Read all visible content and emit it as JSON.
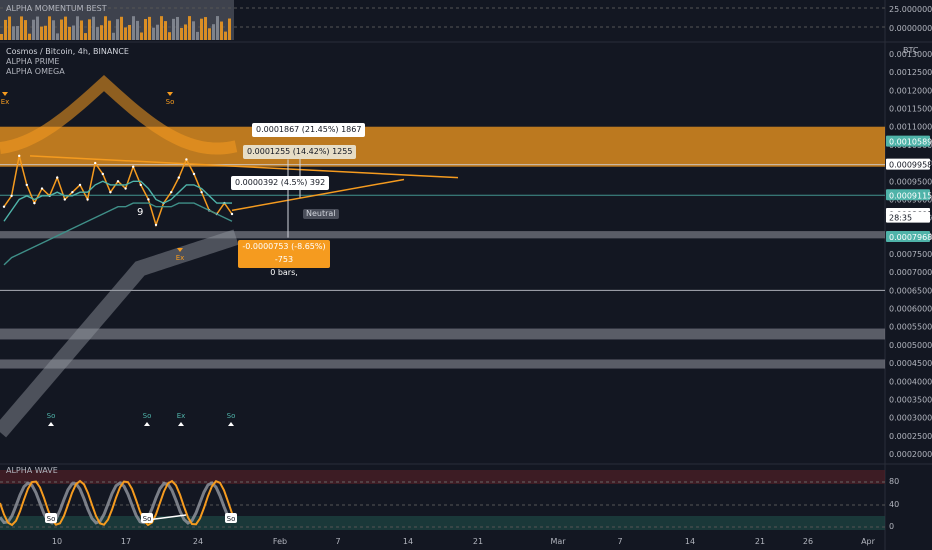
{
  "header": {
    "symbol": "Cosmos / Bitcoin, 4h, BINANCE",
    "indicator_1": "ALPHA PRIME",
    "indicator_2": "ALPHA OMEGA",
    "top_pane_title": "ALPHA MOMENTUM BEST",
    "bottom_pane_title": "ALPHA WAVE",
    "currency": "BTC"
  },
  "colors": {
    "background": "#131722",
    "orange": "#f59b1f",
    "teal": "#4fb3a9",
    "grid": "#2a2e39",
    "text": "#b2b5be",
    "white": "#ffffff"
  },
  "top_pane": {
    "axis_label": "25.0000000",
    "axis_label_2": "0.0000000"
  },
  "chart_data": {
    "type": "line",
    "title": "Cosmos / Bitcoin, 4h, BINANCE",
    "x_ticks": [
      "10",
      "17",
      "24",
      "Feb",
      "7",
      "14",
      "21",
      "Mar",
      "7",
      "14",
      "21",
      "26",
      "Apr"
    ],
    "y_ticks": [
      "0.0013000",
      "0.0012500",
      "0.0012000",
      "0.0011500",
      "0.0011000",
      "0.0010500",
      "0.0010000",
      "0.0009500",
      "0.0009000",
      "0.0008500",
      "0.0008000",
      "0.0007500",
      "0.0007000",
      "0.0006500",
      "0.0006000",
      "0.0005500",
      "0.0005000",
      "0.0004500",
      "0.0004000",
      "0.0003500",
      "0.0003000",
      "0.0002500",
      "0.0002000"
    ],
    "ylim": [
      0.0002,
      0.00135
    ],
    "price_labels": [
      {
        "text": "0.0010589",
        "value": 0.0010589,
        "style": "teal"
      },
      {
        "text": "0.0009958",
        "value": 0.0009958,
        "style": "white"
      },
      {
        "text": "0.0009115",
        "value": 0.0009115,
        "style": "teal"
      },
      {
        "text": "0.0008601",
        "value": 0.0008601,
        "style": "current"
      },
      {
        "text": "28:35",
        "value": 0.00085,
        "style": "time"
      },
      {
        "text": "0.0007968",
        "value": 0.0007968,
        "style": "teal"
      }
    ],
    "horizontal_levels": [
      0.0009958,
      0.0009115,
      0.00065
    ],
    "zones": [
      {
        "from": 0.00099,
        "to": 0.0011,
        "color": "orange"
      },
      {
        "from": 0.000793,
        "to": 0.000813,
        "color": "grey"
      },
      {
        "from": 0.000515,
        "to": 0.000545,
        "color": "grey"
      },
      {
        "from": 0.000435,
        "to": 0.00046,
        "color": "grey"
      }
    ],
    "series": [
      {
        "name": "Price",
        "values": [
          0.00088,
          0.00091,
          0.00102,
          0.00094,
          0.00089,
          0.00093,
          0.00091,
          0.00096,
          0.0009,
          0.00092,
          0.00094,
          0.0009,
          0.001,
          0.00097,
          0.00092,
          0.00095,
          0.00093,
          0.00099,
          0.00094,
          0.0009,
          0.00083,
          0.00089,
          0.00092,
          0.00096,
          0.00101,
          0.00097,
          0.00092,
          0.00087,
          0.00086,
          0.00089,
          0.00086
        ]
      },
      {
        "name": "Fast MA",
        "values": [
          0.00084,
          0.00087,
          0.0009,
          0.00091,
          0.0009,
          0.00091,
          0.00091,
          0.00092,
          0.00091,
          0.00091,
          0.00092,
          0.00092,
          0.00094,
          0.00095,
          0.00094,
          0.00094,
          0.00094,
          0.00095,
          0.00095,
          0.00093,
          0.0009,
          0.00089,
          0.0009,
          0.00092,
          0.00094,
          0.00094,
          0.00093,
          0.00091,
          0.00089,
          0.00089,
          0.00089
        ]
      },
      {
        "name": "Slow MA",
        "values": [
          0.00072,
          0.00074,
          0.00075,
          0.00076,
          0.00077,
          0.00078,
          0.00079,
          0.0008,
          0.00081,
          0.00082,
          0.00083,
          0.00084,
          0.00085,
          0.00086,
          0.00087,
          0.00088,
          0.00088,
          0.00089,
          0.00089,
          0.00089,
          0.00088,
          0.00088,
          0.00088,
          0.00089,
          0.00089,
          0.00089,
          0.00088,
          0.00087,
          0.00086,
          0.00085,
          0.00084
        ]
      }
    ],
    "annotations": {
      "measure_1": "0.0001867 (21.45%) 1867",
      "measure_2": "0.0001255 (14.42%) 1255",
      "measure_3": "0.0000392 (4.5%) 392",
      "measure_4": "-0.0000753 (-8.65%) -753",
      "measure_4b": "0 bars,",
      "neutral": "Neutral",
      "count": "9",
      "signals": [
        {
          "text": "Ex",
          "kind": "down"
        },
        {
          "text": "So",
          "kind": "down"
        },
        {
          "text": "Ex",
          "kind": "down"
        },
        {
          "text": "So",
          "kind": "up"
        },
        {
          "text": "So",
          "kind": "up"
        },
        {
          "text": "Ex",
          "kind": "up"
        },
        {
          "text": "So",
          "kind": "up"
        }
      ]
    }
  },
  "bottom_pane": {
    "axis": [
      "80",
      "40",
      "0"
    ],
    "signals": [
      "So",
      "So",
      "So"
    ]
  }
}
